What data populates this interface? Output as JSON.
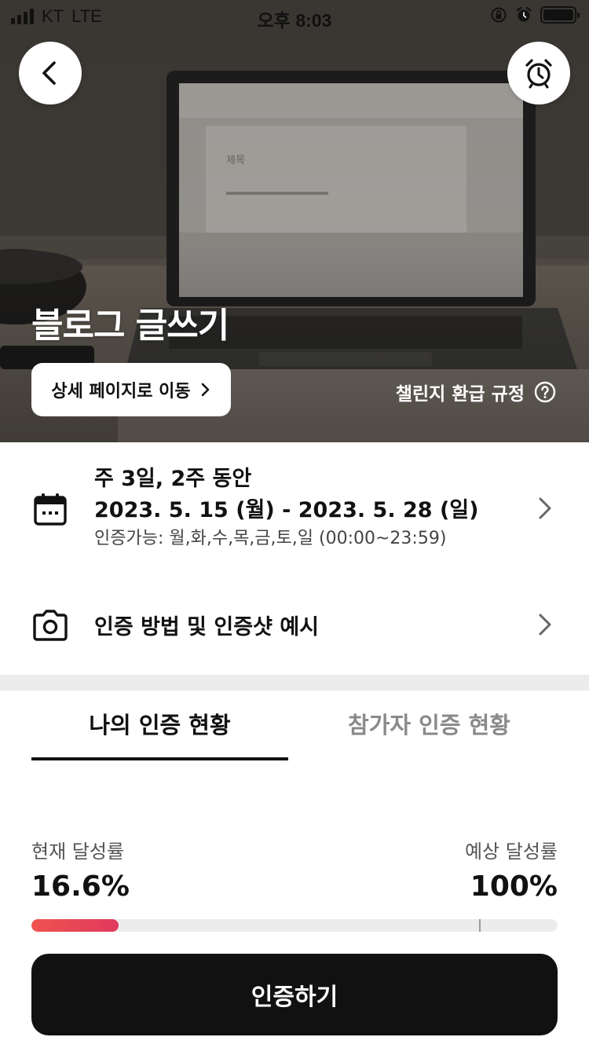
{
  "status_bar": {
    "carrier": "KT",
    "network": "LTE",
    "time": "오후 8:03"
  },
  "header": {
    "back_icon": "chevron-left-icon",
    "alarm_icon": "alarm-clock-icon"
  },
  "hero": {
    "title": "블로그 글쓰기",
    "detail_button_label": "상세 페이지로 이동",
    "refund_link_label": "챌린지 환급 규정",
    "doc_heading": "제목"
  },
  "schedule": {
    "frequency": "주 3일, 2주 동안",
    "date_range": "2023. 5. 15 (월) - 2023. 5. 28 (일)",
    "available": "인증가능: 월,화,수,목,금,토,일 (00:00~23:59)",
    "icon": "calendar-icon"
  },
  "method": {
    "label": "인증 방법 및 인증샷 예시",
    "icon": "camera-icon"
  },
  "tabs": {
    "mine": "나의 인증 현황",
    "others": "참가자 인증 현황",
    "active": "mine"
  },
  "progress": {
    "current_label": "현재 달성률",
    "current_value": "16.6%",
    "expected_label": "예상 달성률",
    "expected_value": "100%",
    "current_fraction": 0.166,
    "marker_fraction": 0.85
  },
  "cta": {
    "label": "인증하기"
  },
  "colors": {
    "progress_fill": "#e8465a",
    "cta_background": "#111111",
    "divider": "#ececec"
  }
}
